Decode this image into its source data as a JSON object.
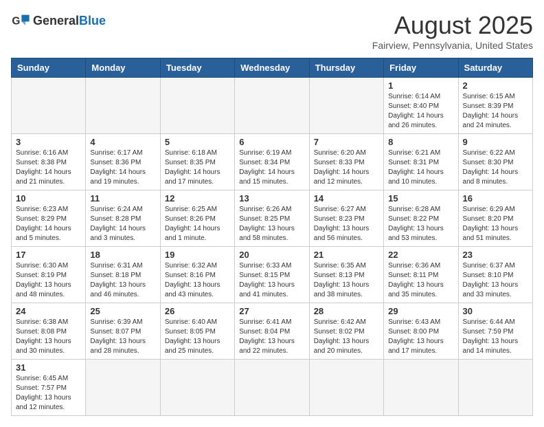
{
  "logo": {
    "text_general": "General",
    "text_blue": "Blue"
  },
  "header": {
    "month": "August 2025",
    "location": "Fairview, Pennsylvania, United States"
  },
  "days_of_week": [
    "Sunday",
    "Monday",
    "Tuesday",
    "Wednesday",
    "Thursday",
    "Friday",
    "Saturday"
  ],
  "weeks": [
    [
      {
        "day": "",
        "info": ""
      },
      {
        "day": "",
        "info": ""
      },
      {
        "day": "",
        "info": ""
      },
      {
        "day": "",
        "info": ""
      },
      {
        "day": "",
        "info": ""
      },
      {
        "day": "1",
        "info": "Sunrise: 6:14 AM\nSunset: 8:40 PM\nDaylight: 14 hours and 26 minutes."
      },
      {
        "day": "2",
        "info": "Sunrise: 6:15 AM\nSunset: 8:39 PM\nDaylight: 14 hours and 24 minutes."
      }
    ],
    [
      {
        "day": "3",
        "info": "Sunrise: 6:16 AM\nSunset: 8:38 PM\nDaylight: 14 hours and 21 minutes."
      },
      {
        "day": "4",
        "info": "Sunrise: 6:17 AM\nSunset: 8:36 PM\nDaylight: 14 hours and 19 minutes."
      },
      {
        "day": "5",
        "info": "Sunrise: 6:18 AM\nSunset: 8:35 PM\nDaylight: 14 hours and 17 minutes."
      },
      {
        "day": "6",
        "info": "Sunrise: 6:19 AM\nSunset: 8:34 PM\nDaylight: 14 hours and 15 minutes."
      },
      {
        "day": "7",
        "info": "Sunrise: 6:20 AM\nSunset: 8:33 PM\nDaylight: 14 hours and 12 minutes."
      },
      {
        "day": "8",
        "info": "Sunrise: 6:21 AM\nSunset: 8:31 PM\nDaylight: 14 hours and 10 minutes."
      },
      {
        "day": "9",
        "info": "Sunrise: 6:22 AM\nSunset: 8:30 PM\nDaylight: 14 hours and 8 minutes."
      }
    ],
    [
      {
        "day": "10",
        "info": "Sunrise: 6:23 AM\nSunset: 8:29 PM\nDaylight: 14 hours and 5 minutes."
      },
      {
        "day": "11",
        "info": "Sunrise: 6:24 AM\nSunset: 8:28 PM\nDaylight: 14 hours and 3 minutes."
      },
      {
        "day": "12",
        "info": "Sunrise: 6:25 AM\nSunset: 8:26 PM\nDaylight: 14 hours and 1 minute."
      },
      {
        "day": "13",
        "info": "Sunrise: 6:26 AM\nSunset: 8:25 PM\nDaylight: 13 hours and 58 minutes."
      },
      {
        "day": "14",
        "info": "Sunrise: 6:27 AM\nSunset: 8:23 PM\nDaylight: 13 hours and 56 minutes."
      },
      {
        "day": "15",
        "info": "Sunrise: 6:28 AM\nSunset: 8:22 PM\nDaylight: 13 hours and 53 minutes."
      },
      {
        "day": "16",
        "info": "Sunrise: 6:29 AM\nSunset: 8:20 PM\nDaylight: 13 hours and 51 minutes."
      }
    ],
    [
      {
        "day": "17",
        "info": "Sunrise: 6:30 AM\nSunset: 8:19 PM\nDaylight: 13 hours and 48 minutes."
      },
      {
        "day": "18",
        "info": "Sunrise: 6:31 AM\nSunset: 8:18 PM\nDaylight: 13 hours and 46 minutes."
      },
      {
        "day": "19",
        "info": "Sunrise: 6:32 AM\nSunset: 8:16 PM\nDaylight: 13 hours and 43 minutes."
      },
      {
        "day": "20",
        "info": "Sunrise: 6:33 AM\nSunset: 8:15 PM\nDaylight: 13 hours and 41 minutes."
      },
      {
        "day": "21",
        "info": "Sunrise: 6:35 AM\nSunset: 8:13 PM\nDaylight: 13 hours and 38 minutes."
      },
      {
        "day": "22",
        "info": "Sunrise: 6:36 AM\nSunset: 8:11 PM\nDaylight: 13 hours and 35 minutes."
      },
      {
        "day": "23",
        "info": "Sunrise: 6:37 AM\nSunset: 8:10 PM\nDaylight: 13 hours and 33 minutes."
      }
    ],
    [
      {
        "day": "24",
        "info": "Sunrise: 6:38 AM\nSunset: 8:08 PM\nDaylight: 13 hours and 30 minutes."
      },
      {
        "day": "25",
        "info": "Sunrise: 6:39 AM\nSunset: 8:07 PM\nDaylight: 13 hours and 28 minutes."
      },
      {
        "day": "26",
        "info": "Sunrise: 6:40 AM\nSunset: 8:05 PM\nDaylight: 13 hours and 25 minutes."
      },
      {
        "day": "27",
        "info": "Sunrise: 6:41 AM\nSunset: 8:04 PM\nDaylight: 13 hours and 22 minutes."
      },
      {
        "day": "28",
        "info": "Sunrise: 6:42 AM\nSunset: 8:02 PM\nDaylight: 13 hours and 20 minutes."
      },
      {
        "day": "29",
        "info": "Sunrise: 6:43 AM\nSunset: 8:00 PM\nDaylight: 13 hours and 17 minutes."
      },
      {
        "day": "30",
        "info": "Sunrise: 6:44 AM\nSunset: 7:59 PM\nDaylight: 13 hours and 14 minutes."
      }
    ],
    [
      {
        "day": "31",
        "info": "Sunrise: 6:45 AM\nSunset: 7:57 PM\nDaylight: 13 hours and 12 minutes."
      },
      {
        "day": "",
        "info": ""
      },
      {
        "day": "",
        "info": ""
      },
      {
        "day": "",
        "info": ""
      },
      {
        "day": "",
        "info": ""
      },
      {
        "day": "",
        "info": ""
      },
      {
        "day": "",
        "info": ""
      }
    ]
  ]
}
